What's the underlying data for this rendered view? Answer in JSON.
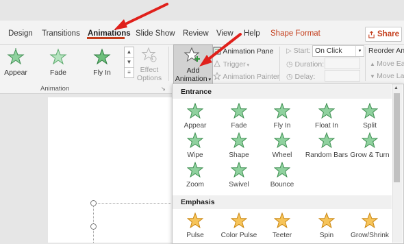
{
  "tabs": [
    "Design",
    "Transitions",
    "Animations",
    "Slide Show",
    "Review",
    "View",
    "Help",
    "Shape Format"
  ],
  "share_label": "Share",
  "gallery": [
    "Appear",
    "Fade",
    "Fly In"
  ],
  "effect_options": [
    "Effect",
    "Options"
  ],
  "add_animation": [
    "Add",
    "Animation"
  ],
  "group_label": "Animation",
  "advanced": {
    "pane": "Animation Pane",
    "trigger": "Trigger",
    "painter": "Animation Painter"
  },
  "timing": {
    "start_label": "Start:",
    "start_value": "On Click",
    "duration_label": "Duration:",
    "delay_label": "Delay:"
  },
  "reorder": {
    "title": "Reorder Ani",
    "earlier": "Move Ea",
    "later": "Move La"
  },
  "dropdown": {
    "entrance_title": "Entrance",
    "entrance": [
      "Appear",
      "Fade",
      "Fly In",
      "Float In",
      "Split",
      "Wipe",
      "Shape",
      "Wheel",
      "Random Bars",
      "Grow & Turn",
      "Zoom",
      "Swivel",
      "Bounce"
    ],
    "emphasis_title": "Emphasis",
    "emphasis": [
      "Pulse",
      "Color Pulse",
      "Teeter",
      "Spin",
      "Grow/Shrink"
    ]
  },
  "colors": {
    "accent": "#c43e1c",
    "entrance_star": "#6dbf7b",
    "emphasis_star": "#f2b134",
    "arrow": "#e0201b"
  }
}
